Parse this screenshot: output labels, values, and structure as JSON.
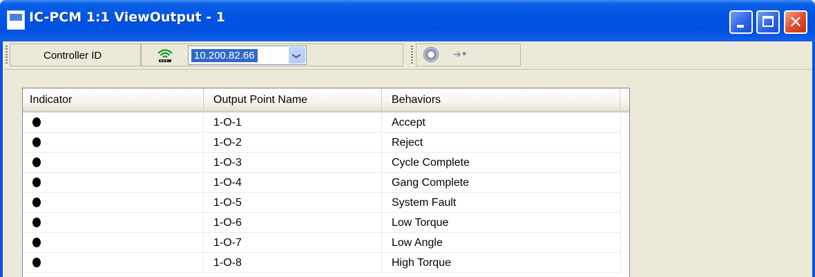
{
  "window": {
    "title": "IC-PCM 1:1 ViewOutput - 1",
    "close_glyph": "✕"
  },
  "toolbar": {
    "controller_label": "Controller ID",
    "controller_value": "10.200.82.66",
    "combo_arrow": "❯",
    "icons": [
      "network-icon",
      "refresh-icon",
      "connect-icon"
    ],
    "connect_glyph": "➔•"
  },
  "table": {
    "columns": [
      "Indicator",
      "Output Point Name",
      "Behaviors"
    ],
    "rows": [
      {
        "indicator": "off",
        "name": "1-O-1",
        "behavior": "Accept"
      },
      {
        "indicator": "off",
        "name": "1-O-2",
        "behavior": "Reject"
      },
      {
        "indicator": "off",
        "name": "1-O-3",
        "behavior": "Cycle Complete"
      },
      {
        "indicator": "off",
        "name": "1-O-4",
        "behavior": "Gang Complete"
      },
      {
        "indicator": "off",
        "name": "1-O-5",
        "behavior": "System Fault"
      },
      {
        "indicator": "off",
        "name": "1-O-6",
        "behavior": "Low Torque"
      },
      {
        "indicator": "off",
        "name": "1-O-7",
        "behavior": "Low Angle"
      },
      {
        "indicator": "off",
        "name": "1-O-8",
        "behavior": "High Torque"
      }
    ]
  },
  "colors": {
    "titlebar": "#0054e3",
    "selection": "#316ac5",
    "indicator_off": "#000000",
    "network_icon": "#1e9e2e"
  }
}
